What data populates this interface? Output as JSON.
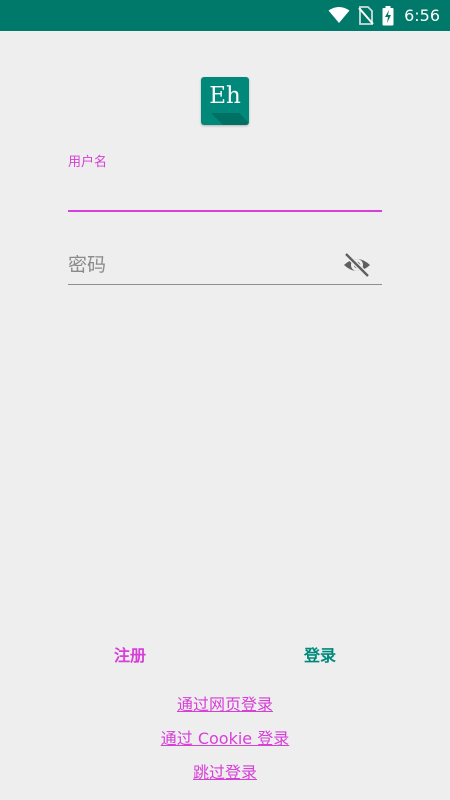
{
  "status_bar": {
    "time": "6:56",
    "background_color": "#00786a",
    "icons": [
      "wifi-icon",
      "no-sim-icon",
      "battery-charging-icon"
    ]
  },
  "logo": {
    "text": "Eh",
    "color": "#00897b"
  },
  "username": {
    "label": "用户名",
    "value": "",
    "accent_color": "#d63fd8"
  },
  "password": {
    "placeholder": "密码",
    "value": "",
    "visibility_icon": "visibility-off-icon"
  },
  "actions": {
    "register_label": "注册",
    "login_label": "登录",
    "register_color": "#d63fd8",
    "login_color": "#00897b"
  },
  "links": {
    "web_login": "通过网页登录",
    "cookie_login": "通过 Cookie 登录",
    "skip_login": "跳过登录"
  }
}
